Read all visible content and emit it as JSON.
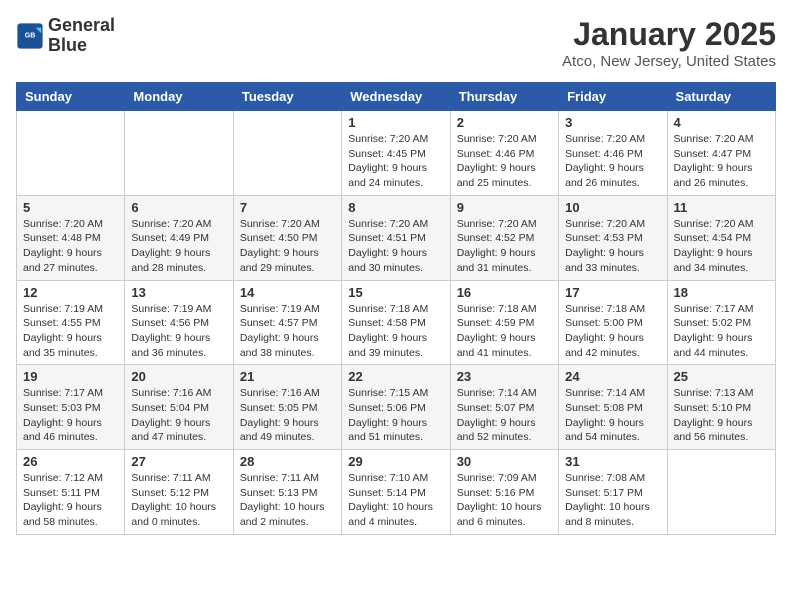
{
  "logo": {
    "line1": "General",
    "line2": "Blue"
  },
  "title": "January 2025",
  "location": "Atco, New Jersey, United States",
  "weekdays": [
    "Sunday",
    "Monday",
    "Tuesday",
    "Wednesday",
    "Thursday",
    "Friday",
    "Saturday"
  ],
  "weeks": [
    [
      {
        "day": "",
        "info": ""
      },
      {
        "day": "",
        "info": ""
      },
      {
        "day": "",
        "info": ""
      },
      {
        "day": "1",
        "info": "Sunrise: 7:20 AM\nSunset: 4:45 PM\nDaylight: 9 hours\nand 24 minutes."
      },
      {
        "day": "2",
        "info": "Sunrise: 7:20 AM\nSunset: 4:46 PM\nDaylight: 9 hours\nand 25 minutes."
      },
      {
        "day": "3",
        "info": "Sunrise: 7:20 AM\nSunset: 4:46 PM\nDaylight: 9 hours\nand 26 minutes."
      },
      {
        "day": "4",
        "info": "Sunrise: 7:20 AM\nSunset: 4:47 PM\nDaylight: 9 hours\nand 26 minutes."
      }
    ],
    [
      {
        "day": "5",
        "info": "Sunrise: 7:20 AM\nSunset: 4:48 PM\nDaylight: 9 hours\nand 27 minutes."
      },
      {
        "day": "6",
        "info": "Sunrise: 7:20 AM\nSunset: 4:49 PM\nDaylight: 9 hours\nand 28 minutes."
      },
      {
        "day": "7",
        "info": "Sunrise: 7:20 AM\nSunset: 4:50 PM\nDaylight: 9 hours\nand 29 minutes."
      },
      {
        "day": "8",
        "info": "Sunrise: 7:20 AM\nSunset: 4:51 PM\nDaylight: 9 hours\nand 30 minutes."
      },
      {
        "day": "9",
        "info": "Sunrise: 7:20 AM\nSunset: 4:52 PM\nDaylight: 9 hours\nand 31 minutes."
      },
      {
        "day": "10",
        "info": "Sunrise: 7:20 AM\nSunset: 4:53 PM\nDaylight: 9 hours\nand 33 minutes."
      },
      {
        "day": "11",
        "info": "Sunrise: 7:20 AM\nSunset: 4:54 PM\nDaylight: 9 hours\nand 34 minutes."
      }
    ],
    [
      {
        "day": "12",
        "info": "Sunrise: 7:19 AM\nSunset: 4:55 PM\nDaylight: 9 hours\nand 35 minutes."
      },
      {
        "day": "13",
        "info": "Sunrise: 7:19 AM\nSunset: 4:56 PM\nDaylight: 9 hours\nand 36 minutes."
      },
      {
        "day": "14",
        "info": "Sunrise: 7:19 AM\nSunset: 4:57 PM\nDaylight: 9 hours\nand 38 minutes."
      },
      {
        "day": "15",
        "info": "Sunrise: 7:18 AM\nSunset: 4:58 PM\nDaylight: 9 hours\nand 39 minutes."
      },
      {
        "day": "16",
        "info": "Sunrise: 7:18 AM\nSunset: 4:59 PM\nDaylight: 9 hours\nand 41 minutes."
      },
      {
        "day": "17",
        "info": "Sunrise: 7:18 AM\nSunset: 5:00 PM\nDaylight: 9 hours\nand 42 minutes."
      },
      {
        "day": "18",
        "info": "Sunrise: 7:17 AM\nSunset: 5:02 PM\nDaylight: 9 hours\nand 44 minutes."
      }
    ],
    [
      {
        "day": "19",
        "info": "Sunrise: 7:17 AM\nSunset: 5:03 PM\nDaylight: 9 hours\nand 46 minutes."
      },
      {
        "day": "20",
        "info": "Sunrise: 7:16 AM\nSunset: 5:04 PM\nDaylight: 9 hours\nand 47 minutes."
      },
      {
        "day": "21",
        "info": "Sunrise: 7:16 AM\nSunset: 5:05 PM\nDaylight: 9 hours\nand 49 minutes."
      },
      {
        "day": "22",
        "info": "Sunrise: 7:15 AM\nSunset: 5:06 PM\nDaylight: 9 hours\nand 51 minutes."
      },
      {
        "day": "23",
        "info": "Sunrise: 7:14 AM\nSunset: 5:07 PM\nDaylight: 9 hours\nand 52 minutes."
      },
      {
        "day": "24",
        "info": "Sunrise: 7:14 AM\nSunset: 5:08 PM\nDaylight: 9 hours\nand 54 minutes."
      },
      {
        "day": "25",
        "info": "Sunrise: 7:13 AM\nSunset: 5:10 PM\nDaylight: 9 hours\nand 56 minutes."
      }
    ],
    [
      {
        "day": "26",
        "info": "Sunrise: 7:12 AM\nSunset: 5:11 PM\nDaylight: 9 hours\nand 58 minutes."
      },
      {
        "day": "27",
        "info": "Sunrise: 7:11 AM\nSunset: 5:12 PM\nDaylight: 10 hours\nand 0 minutes."
      },
      {
        "day": "28",
        "info": "Sunrise: 7:11 AM\nSunset: 5:13 PM\nDaylight: 10 hours\nand 2 minutes."
      },
      {
        "day": "29",
        "info": "Sunrise: 7:10 AM\nSunset: 5:14 PM\nDaylight: 10 hours\nand 4 minutes."
      },
      {
        "day": "30",
        "info": "Sunrise: 7:09 AM\nSunset: 5:16 PM\nDaylight: 10 hours\nand 6 minutes."
      },
      {
        "day": "31",
        "info": "Sunrise: 7:08 AM\nSunset: 5:17 PM\nDaylight: 10 hours\nand 8 minutes."
      },
      {
        "day": "",
        "info": ""
      }
    ]
  ]
}
